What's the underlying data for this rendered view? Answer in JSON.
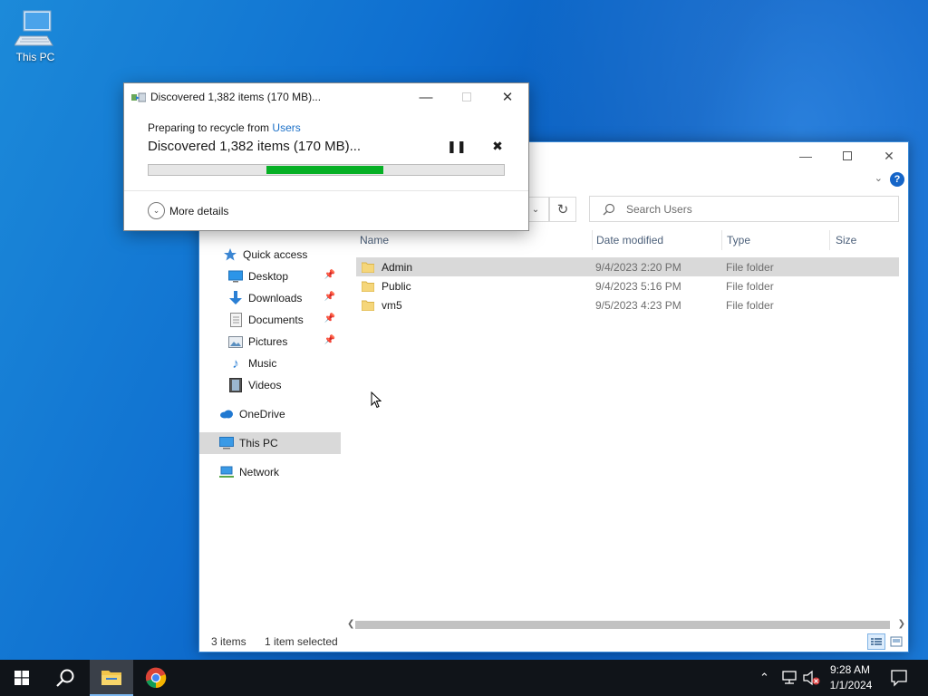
{
  "desktop": {
    "icon_label": "This PC"
  },
  "dialog": {
    "title": "Discovered 1,382 items (170 MB)...",
    "subtitle_prefix": "Preparing to recycle from",
    "subtitle_link": "Users",
    "main_text": "Discovered 1,382 items (170 MB)...",
    "more_details": "More details",
    "progress_fraction": 0.33
  },
  "explorer": {
    "search_placeholder": "Search Users",
    "columns": [
      "Name",
      "Date modified",
      "Type",
      "Size"
    ],
    "nav": {
      "quick_access": "Quick access",
      "desktop": "Desktop",
      "downloads": "Downloads",
      "documents": "Documents",
      "pictures": "Pictures",
      "music": "Music",
      "videos": "Videos",
      "onedrive": "OneDrive",
      "this_pc": "This PC",
      "network": "Network"
    },
    "rows": [
      {
        "name": "Admin",
        "date": "9/4/2023 2:20 PM",
        "type": "File folder"
      },
      {
        "name": "Public",
        "date": "9/4/2023 5:16 PM",
        "type": "File folder"
      },
      {
        "name": "vm5",
        "date": "9/5/2023 4:23 PM",
        "type": "File folder"
      }
    ],
    "status": {
      "items": "3 items",
      "selected": "1 item selected"
    }
  },
  "taskbar": {
    "time": "9:28 AM",
    "date": "1/1/2024"
  },
  "colors": {
    "accent": "#1a6fc7",
    "progress": "#06b025",
    "taskbar": "#101419"
  }
}
